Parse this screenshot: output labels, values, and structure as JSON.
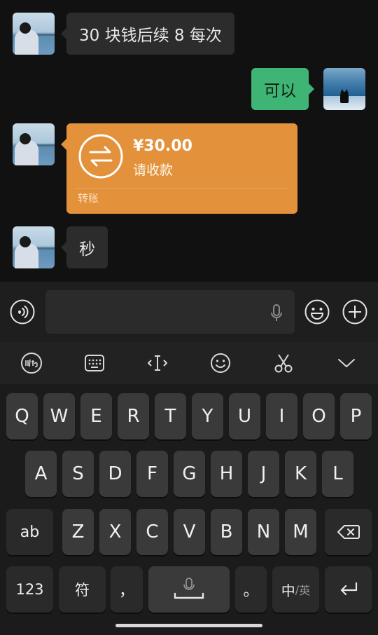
{
  "messages": [
    {
      "from": "them",
      "text": "30 块钱后续 8 每次"
    },
    {
      "from": "me",
      "text": "可以"
    },
    {
      "from": "them",
      "type": "transfer",
      "amount": "¥30.00",
      "subtitle": "请收款",
      "label": "转账"
    },
    {
      "from": "them",
      "text": "秒"
    }
  ],
  "input": {
    "value": "",
    "placeholder": ""
  },
  "toolbar": [
    "handwriting-icon",
    "keyboard-icon",
    "cursor-icon",
    "emoji-icon",
    "scissors-icon",
    "chevron-down-icon"
  ],
  "keyboard": {
    "row1": [
      "Q",
      "W",
      "E",
      "R",
      "T",
      "Y",
      "U",
      "I",
      "O",
      "P"
    ],
    "row2": [
      "A",
      "S",
      "D",
      "F",
      "G",
      "H",
      "J",
      "K",
      "L"
    ],
    "row3_left": "ab",
    "row3": [
      "Z",
      "X",
      "C",
      "V",
      "B",
      "N",
      "M"
    ],
    "row4": {
      "num": "123",
      "sym": "符",
      "comma": "，",
      "period": "。",
      "lang_main": "中",
      "lang_sep": "/",
      "lang_alt": "英"
    }
  },
  "colors": {
    "outgoing_bubble": "#3eb575",
    "incoming_bubble": "#2c2c2c",
    "transfer_card": "#e3913a"
  }
}
